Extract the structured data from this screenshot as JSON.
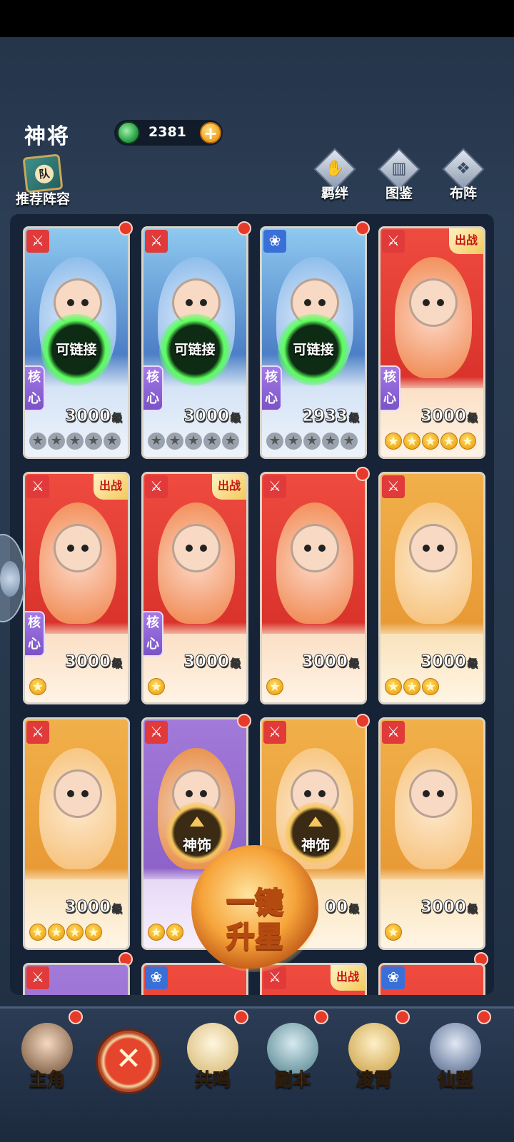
{
  "header": {
    "title": "神将",
    "currency": {
      "amount": "2381",
      "icon": "jade-dragon-icon",
      "plus": "+"
    },
    "recommend": {
      "icon_char": "队",
      "label": "推荐阵容"
    },
    "buttons": [
      {
        "label": "羁绊",
        "icon": "bond-icon",
        "glyph": "✋"
      },
      {
        "label": "图鉴",
        "icon": "book-icon",
        "glyph": "▥"
      },
      {
        "label": "布阵",
        "icon": "formation-icon",
        "glyph": "❖"
      }
    ]
  },
  "cards": [
    {
      "level": "3000",
      "unit": "级",
      "stars_filled": 0,
      "stars_total": 5,
      "core": "核心",
      "action": "可链接",
      "type": "sword",
      "deployed": false,
      "palette": "blue"
    },
    {
      "level": "3000",
      "unit": "级",
      "stars_filled": 0,
      "stars_total": 5,
      "core": "核心",
      "action": "可链接",
      "type": "sword",
      "deployed": false,
      "palette": "blue"
    },
    {
      "level": "2933",
      "unit": "级",
      "stars_filled": 0,
      "stars_total": 5,
      "core": "核心",
      "action": "可链接",
      "type": "lotus",
      "deployed": false,
      "palette": "blue"
    },
    {
      "level": "3000",
      "unit": "级",
      "stars_filled": 5,
      "stars_total": 5,
      "core": "核心",
      "action": "",
      "type": "sword",
      "deployed": true,
      "palette": "red"
    },
    {
      "level": "3000",
      "unit": "级",
      "stars_filled": 1,
      "stars_total": 1,
      "core": "核心",
      "action": "",
      "type": "sword",
      "deployed": true,
      "palette": "red"
    },
    {
      "level": "3000",
      "unit": "级",
      "stars_filled": 1,
      "stars_total": 1,
      "core": "核心",
      "action": "",
      "type": "sword",
      "deployed": true,
      "palette": "red"
    },
    {
      "level": "3000",
      "unit": "级",
      "stars_filled": 1,
      "stars_total": 1,
      "core": "",
      "action": "",
      "type": "sword",
      "deployed": false,
      "palette": "red"
    },
    {
      "level": "3000",
      "unit": "级",
      "stars_filled": 3,
      "stars_total": 3,
      "core": "",
      "action": "",
      "type": "sword",
      "deployed": false,
      "palette": "orange"
    },
    {
      "level": "3000",
      "unit": "级",
      "stars_filled": 4,
      "stars_total": 4,
      "core": "",
      "action": "",
      "type": "sword",
      "deployed": false,
      "palette": "orange"
    },
    {
      "level": "",
      "unit": "",
      "stars_filled": 2,
      "stars_total": 2,
      "core": "",
      "action": "神饰",
      "type": "sword",
      "deployed": false,
      "palette": "purple"
    },
    {
      "level": "00",
      "unit": "级",
      "stars_filled": 2,
      "stars_total": 2,
      "core": "",
      "action": "神饰",
      "type": "sword",
      "deployed": false,
      "palette": "orange"
    },
    {
      "level": "3000",
      "unit": "级",
      "stars_filled": 1,
      "stars_total": 1,
      "core": "",
      "action": "",
      "type": "sword",
      "deployed": false,
      "palette": "orange"
    }
  ],
  "partial_row": [
    {
      "type": "sword",
      "deployed": false,
      "palette": "purple"
    },
    {
      "type": "lotus",
      "deployed": false,
      "palette": "red"
    },
    {
      "type": "sword",
      "deployed": true,
      "palette": "red"
    },
    {
      "type": "lotus",
      "deployed": false,
      "palette": "red"
    }
  ],
  "deployed_label": "出战",
  "upstar": {
    "line1": "一键",
    "line2": "升星"
  },
  "bottom_nav": [
    {
      "label": "主角",
      "icon": "hero-avatar-icon"
    },
    {
      "label": "",
      "icon": "close-icon",
      "glyph": "✕"
    },
    {
      "label": "共鸣",
      "icon": "gourd-icon"
    },
    {
      "label": "副本",
      "icon": "dungeon-icon"
    },
    {
      "label": "凌霄",
      "icon": "palace-icon"
    },
    {
      "label": "仙盟",
      "icon": "alliance-pavilion-icon"
    }
  ],
  "colors": {
    "red_dot": "#e63b2a",
    "core_tag": "#8a5fd6",
    "chain_glow": "#5bff5b",
    "gold": "#f0a516"
  }
}
